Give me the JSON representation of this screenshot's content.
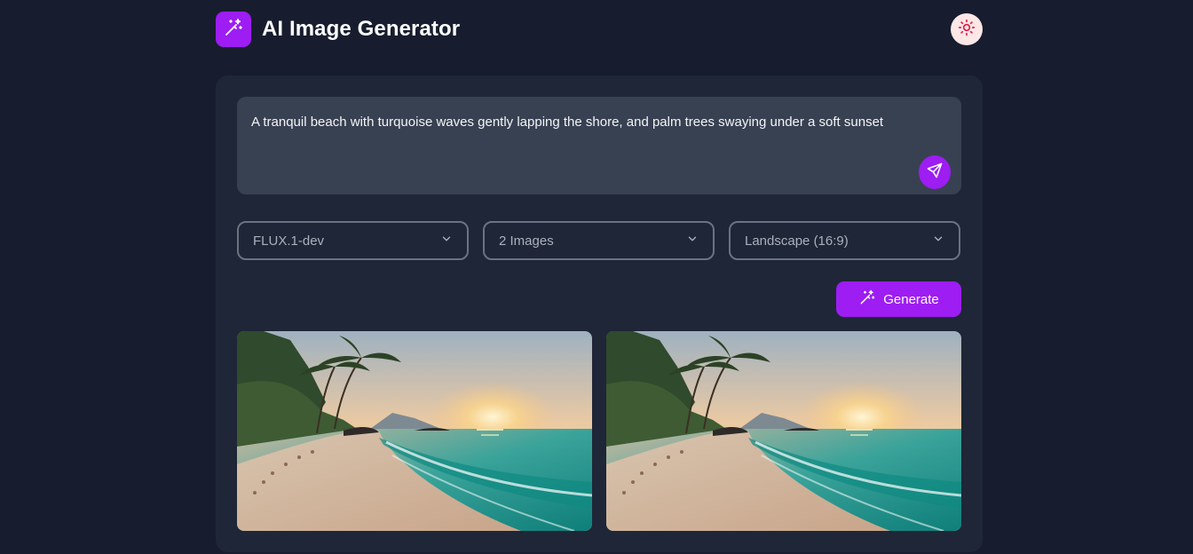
{
  "header": {
    "title": "AI Image Generator",
    "logo_icon": "magic-wand-icon",
    "theme_icon": "sun-icon"
  },
  "prompt": {
    "text": "A tranquil beach with turquoise waves gently lapping the shore, and palm trees swaying under a soft sunset",
    "send_icon": "send-icon"
  },
  "options": {
    "model": "FLUX.1-dev",
    "count": "2 Images",
    "ratio": "Landscape (16:9)"
  },
  "generate": {
    "label": "Generate",
    "icon": "magic-wand-icon"
  },
  "gallery": {
    "images": [
      {
        "scene": "beach-sunset-palms"
      },
      {
        "scene": "beach-sunset-palms"
      }
    ]
  },
  "colors": {
    "background": "#171d2e",
    "card": "#1f2637",
    "input": "#384152",
    "accent": "#9d1df2",
    "theme_button": "#fde7e7"
  }
}
